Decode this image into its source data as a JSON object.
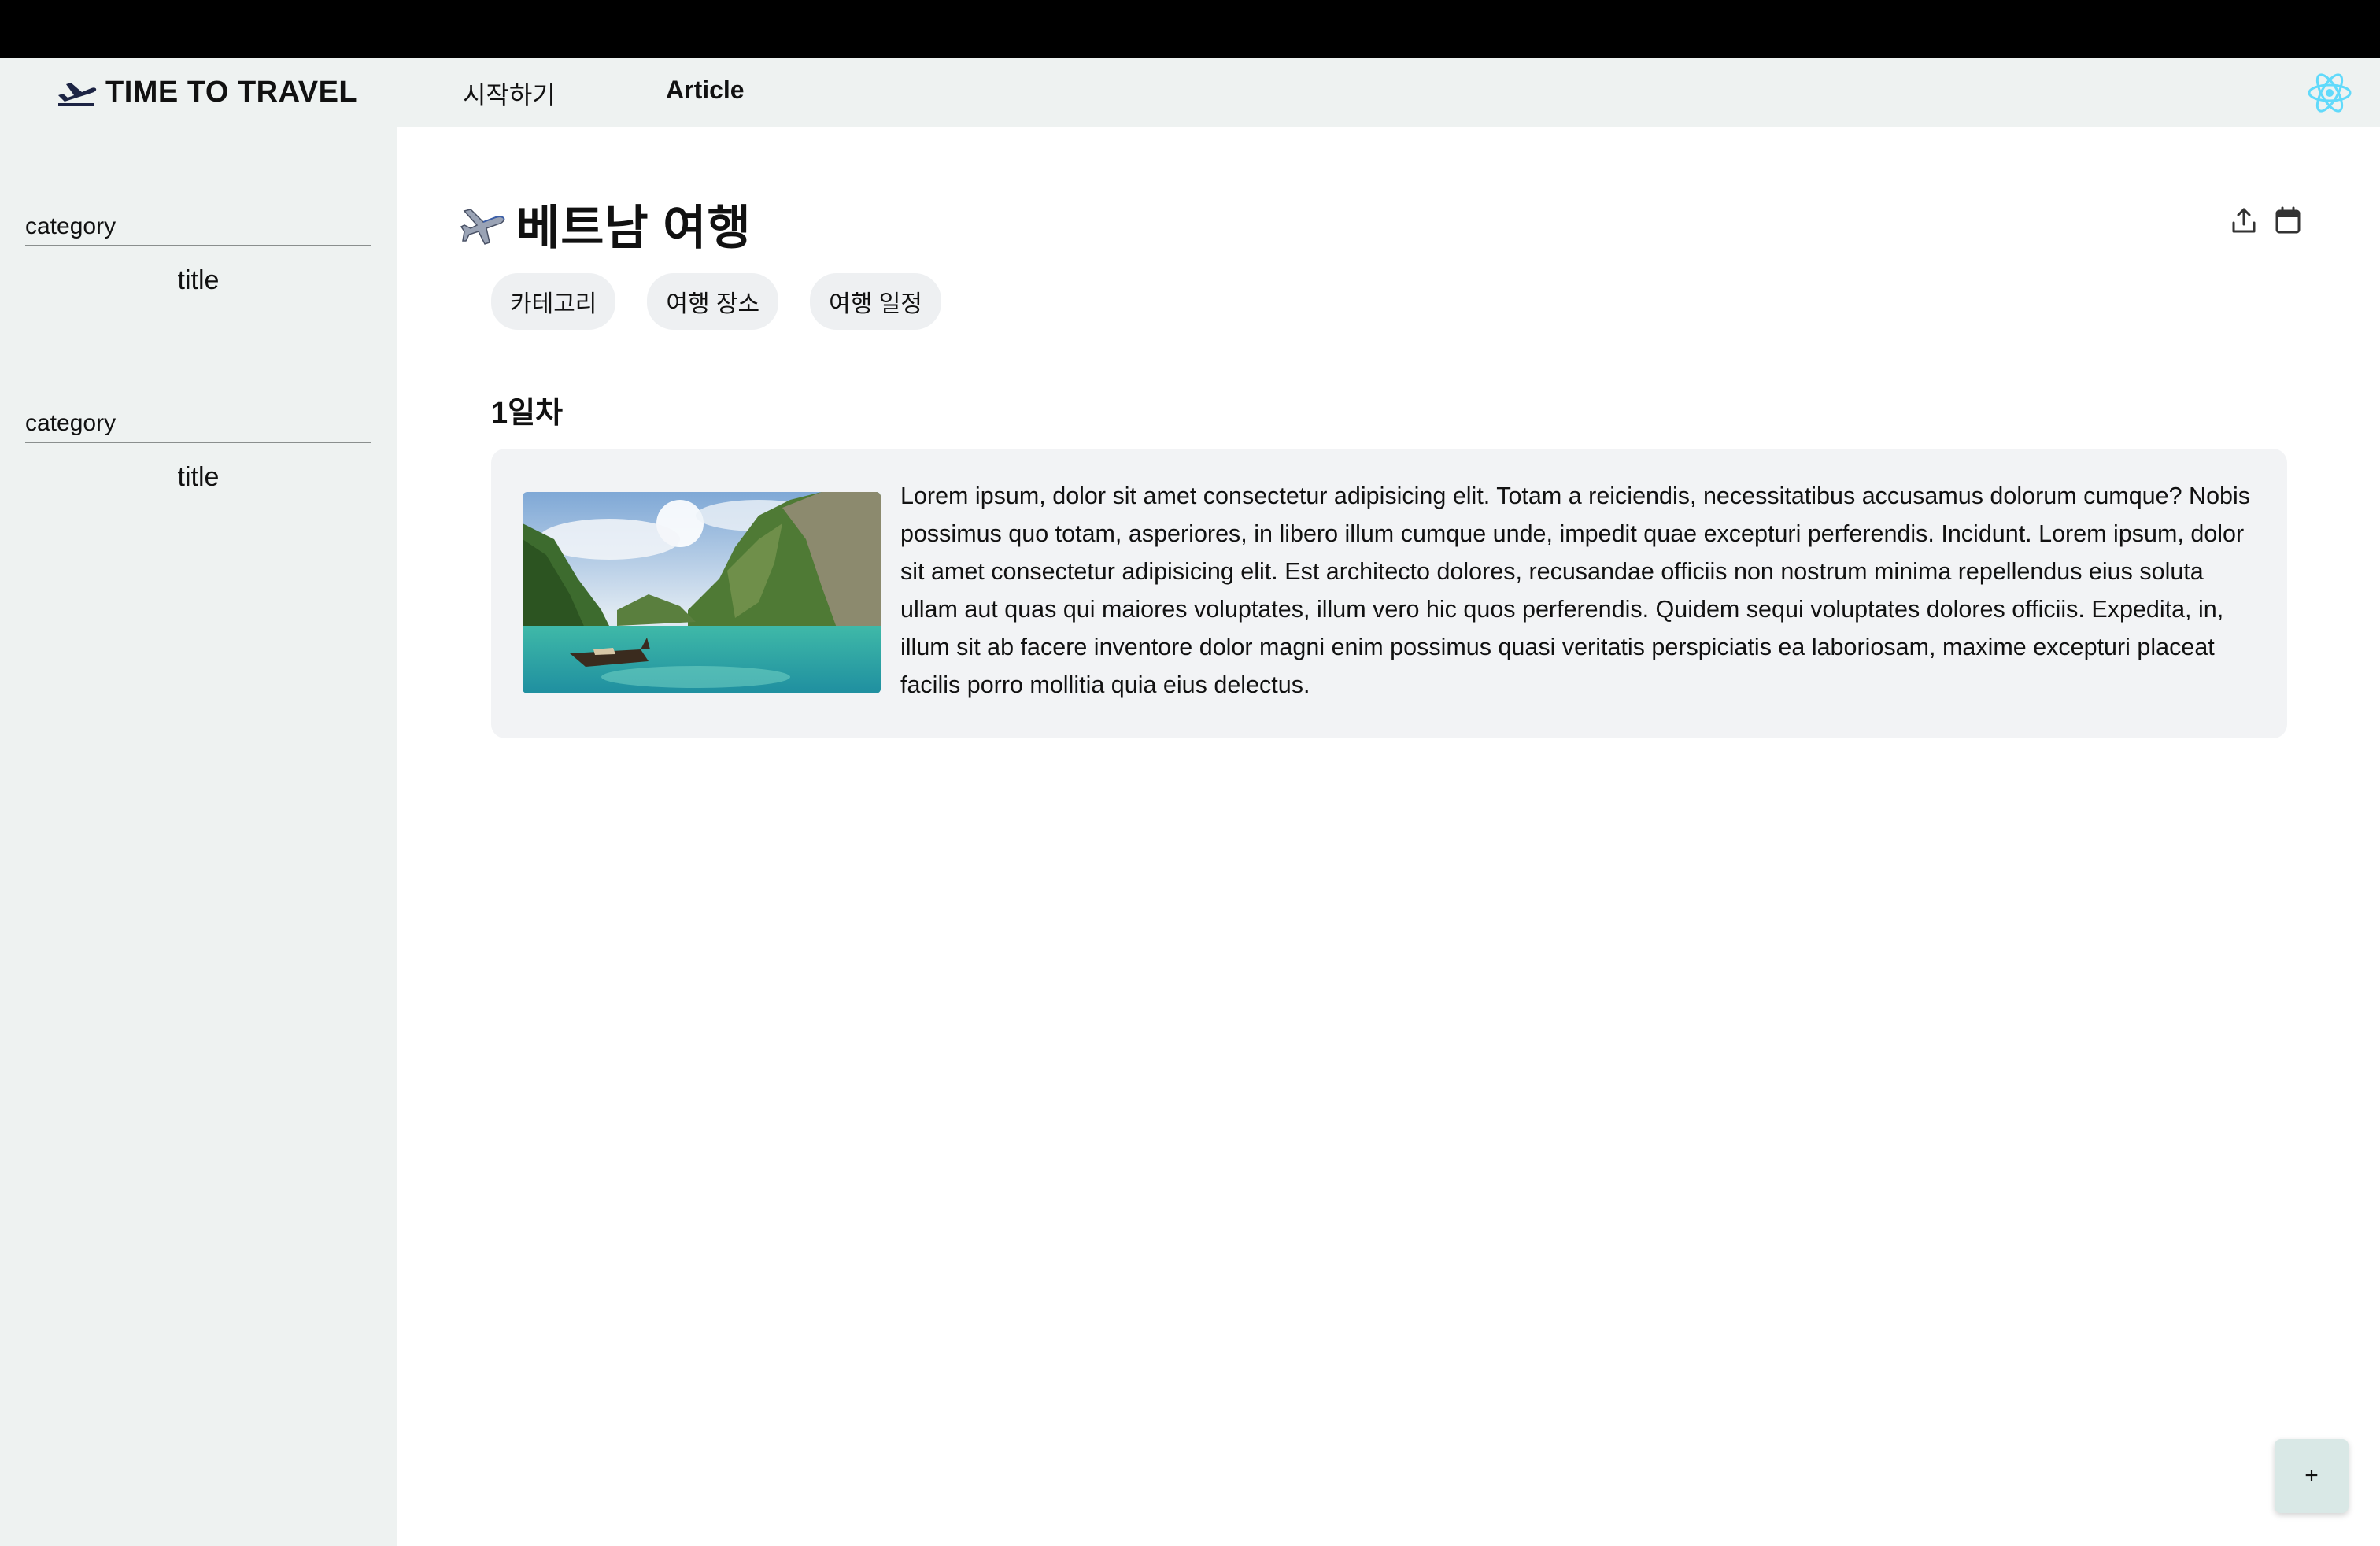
{
  "header": {
    "brand": "TIME TO TRAVEL",
    "nav": {
      "start": "시작하기",
      "article": "Article"
    },
    "icons": {
      "logo": "airplane-takeoff-icon",
      "theme": "react-atom-icon"
    }
  },
  "sidebar": {
    "groups": [
      {
        "category": "category",
        "title": "title"
      },
      {
        "category": "category",
        "title": "title"
      }
    ]
  },
  "main": {
    "title": "베트남 여행",
    "title_icon": "airplane-icon",
    "actions": [
      "share-icon",
      "calendar-icon"
    ],
    "tags": [
      "카테고리",
      "여행 장소",
      "여행 일정"
    ],
    "day": "1일차",
    "entry": {
      "image": "tropical-lagoon-boat-photo",
      "text": "Lorem ipsum, dolor sit amet consectetur adipisicing elit. Totam a reiciendis, necessitatibus accusamus dolorum cumque? Nobis possimus quo totam, asperiores, in libero illum cumque unde, impedit quae excepturi perferendis. Incidunt. Lorem ipsum, dolor sit amet consectetur adipisicing elit. Est architecto dolores, recusandae officiis non nostrum minima repellendus eius soluta ullam aut quas qui maiores voluptates, illum vero hic quos perferendis. Quidem sequi voluptates dolores officiis. Expedita, in, illum sit ab facere inventore dolor magni enim possimus quasi veritatis perspiciatis ea laboriosam, maxime excepturi placeat facilis porro mollitia quia eius delectus."
    },
    "fab_label": "+"
  },
  "colors": {
    "chrome": "#000000",
    "nav_bg": "#eef2f1",
    "sidebar_bg": "#eef2f1",
    "card_bg": "#f2f3f5",
    "tag_bg": "#eef0f2",
    "fab_bg": "#d9e8e6",
    "react_accent": "#61dafb"
  }
}
